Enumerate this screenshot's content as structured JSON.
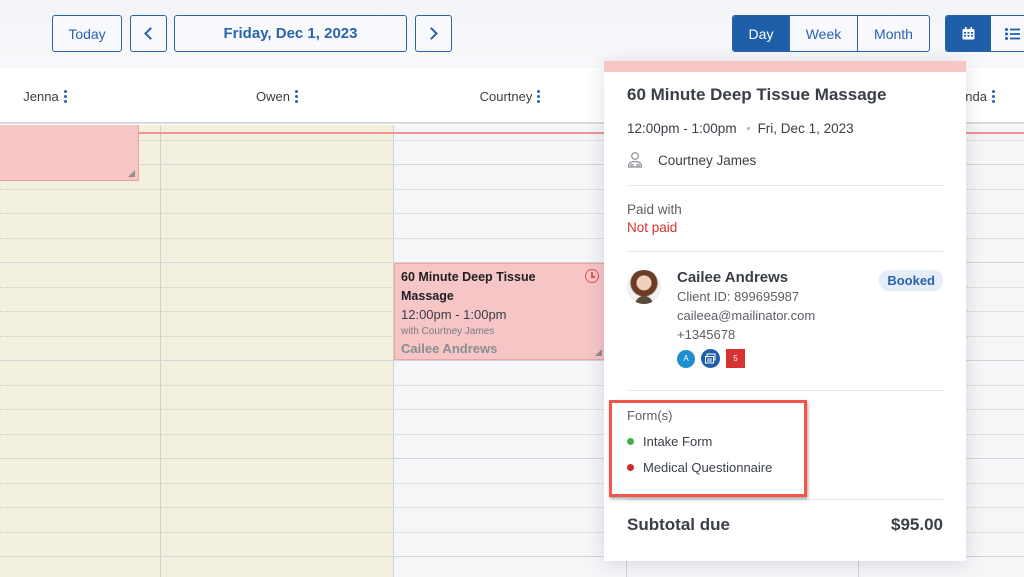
{
  "toolbar": {
    "today_label": "Today",
    "current_date": "Friday, Dec 1, 2023",
    "views": [
      {
        "label": "Day",
        "active": true
      },
      {
        "label": "Week",
        "active": false
      },
      {
        "label": "Month",
        "active": false
      }
    ],
    "layout_icons": [
      "calendar-grid-icon",
      "list-icon"
    ]
  },
  "calendar": {
    "columns": [
      {
        "name": "Jenna",
        "off": true
      },
      {
        "name": "Owen",
        "off": true
      },
      {
        "name": "Courtney",
        "off": false
      },
      {
        "name": "",
        "off": false
      },
      {
        "name": "anda",
        "off": false
      }
    ],
    "event": {
      "title": "60 Minute Deep Tissue Massage",
      "time": "12:00pm - 1:00pm",
      "with": "with Courtney James",
      "client": "Cailee Andrews"
    }
  },
  "popup": {
    "title": "60 Minute Deep Tissue Massage",
    "time": "12:00pm - 1:00pm",
    "date": "Fri, Dec 1, 2023",
    "staff": "Courtney James",
    "paid_label": "Paid with",
    "paid_status": "Not paid",
    "client": {
      "name": "Cailee Andrews",
      "client_id": "Client ID: 899695987",
      "email": "caileea@mailinator.com",
      "phone": "+1345678",
      "status": "Booked",
      "tags": [
        "A",
        "notes",
        "5"
      ]
    },
    "forms_label": "Form(s)",
    "forms": [
      {
        "name": "Intake Form",
        "color": "#3bb54a"
      },
      {
        "name": "Medical Questionnaire",
        "color": "#d62a2a"
      }
    ],
    "subtotal_label": "Subtotal due",
    "subtotal_value": "$95.00"
  },
  "colors": {
    "accent": "#1f5faa",
    "event_bg": "#f6c5c6",
    "unavailable_bg": "#f3f0de",
    "highlight": "#f0564a"
  }
}
